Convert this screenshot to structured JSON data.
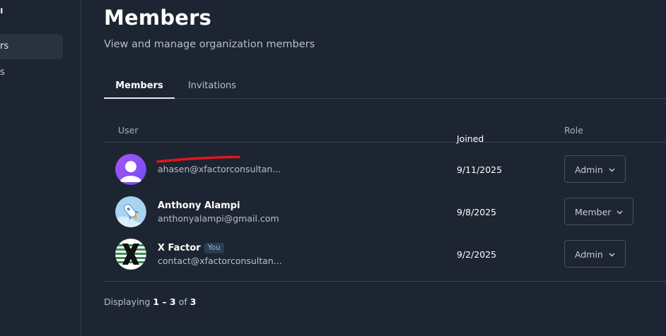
{
  "sidebar": {
    "top_label": "ı",
    "items": [
      {
        "label": "rs"
      },
      {
        "label": "s"
      }
    ]
  },
  "page": {
    "title": "Members",
    "subtitle": "View and manage organization members"
  },
  "tabs": [
    {
      "label": "Members",
      "active": true
    },
    {
      "label": "Invitations",
      "active": false
    }
  ],
  "table": {
    "columns": {
      "user": "User",
      "joined": "Joined",
      "role": "Role"
    },
    "rows": [
      {
        "name": "",
        "email": "ahasen@xfactorconsultan...",
        "joined": "9/11/2025",
        "role": "Admin",
        "avatar": "default-user-icon",
        "name_redacted": true
      },
      {
        "name": "Anthony Alampi",
        "email": "anthonyalampi@gmail.com",
        "joined": "9/8/2025",
        "role": "Member",
        "avatar": "rocket-icon"
      },
      {
        "name": "X Factor",
        "badge": "You",
        "email": "contact@xfactorconsultan...",
        "joined": "9/2/2025",
        "role": "Admin",
        "avatar": "x-logo-icon"
      }
    ]
  },
  "footer": {
    "prefix": "Displaying",
    "range": "1 – 3",
    "of": "of",
    "total": "3"
  },
  "colors": {
    "background": "#1d2532",
    "border": "#3a4352",
    "redaction": "#e0161c",
    "avatar_purple": "#8b5cf6"
  }
}
